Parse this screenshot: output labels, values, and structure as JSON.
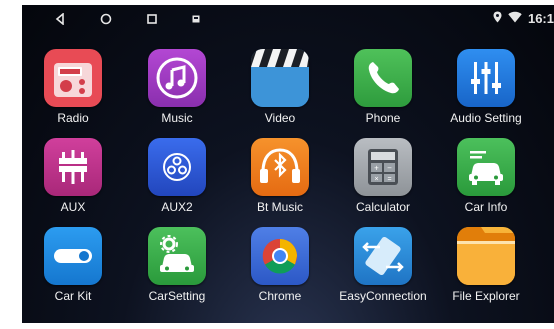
{
  "status": {
    "time": "16:1",
    "icons": [
      "location-icon",
      "wifi-icon"
    ]
  },
  "navbar": {
    "buttons": [
      "back-icon",
      "home-icon",
      "recents-icon",
      "screenshot-icon"
    ]
  },
  "apps": [
    {
      "label": "Radio",
      "icon": "radio-icon",
      "color": "#e84b55"
    },
    {
      "label": "Music",
      "icon": "music-icon",
      "color": "#a43cc0"
    },
    {
      "label": "Video",
      "icon": "video-icon",
      "color": "#2b3d5c"
    },
    {
      "label": "Phone",
      "icon": "phone-icon",
      "color": "#3bb54a"
    },
    {
      "label": "Audio Setting",
      "icon": "equalizer-icon",
      "color": "#1f7fe0"
    },
    {
      "label": "AUX",
      "icon": "aux-icon",
      "color": "#c2348c"
    },
    {
      "label": "AUX2",
      "icon": "aux2-icon",
      "color": "#2c5fe0"
    },
    {
      "label": "Bt Music",
      "icon": "bluetooth-music-icon",
      "color": "#f2801e"
    },
    {
      "label": "Calculator",
      "icon": "calculator-icon",
      "color": "#9aa0a6"
    },
    {
      "label": "Car Info",
      "icon": "car-info-icon",
      "color": "#35b04a"
    },
    {
      "label": "Car Kit",
      "icon": "car-kit-icon",
      "color": "#1e8fe6"
    },
    {
      "label": "CarSetting",
      "icon": "car-setting-icon",
      "color": "#33b14b"
    },
    {
      "label": "Chrome",
      "icon": "chrome-icon",
      "color": "#3c69d6"
    },
    {
      "label": "EasyConnection",
      "icon": "easy-connection-icon",
      "color": "#2a8fd8"
    },
    {
      "label": "File Explorer",
      "icon": "file-explorer-icon",
      "color": "#f5a623"
    }
  ]
}
